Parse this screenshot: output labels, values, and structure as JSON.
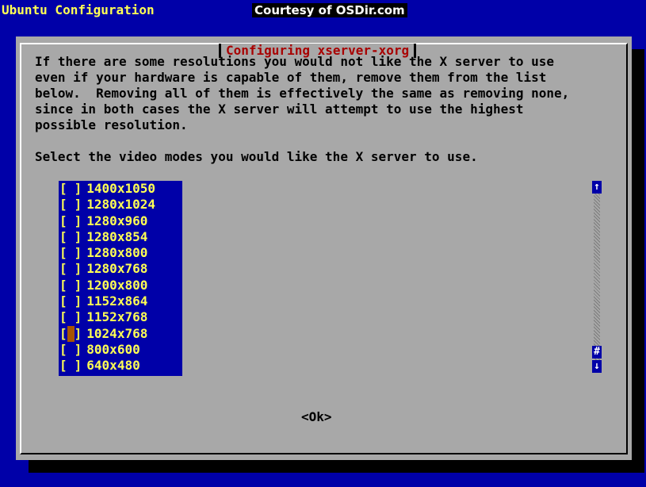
{
  "backtitle": "Ubuntu Configuration",
  "watermark": "Courtesy of OSDir.com",
  "dialog": {
    "title": "Configuring xserver-xorg",
    "description": "If there are some resolutions you would not like the X server to use\neven if your hardware is capable of them, remove them from the list\nbelow.  Removing all of them is effectively the same as removing none,\nsince in both cases the X server will attempt to use the highest\npossible resolution.",
    "prompt": "Select the video modes you would like the X server to use.",
    "ok_label": "<Ok>"
  },
  "modes": [
    {
      "label": "1400x1050",
      "checked": false,
      "cursor": false
    },
    {
      "label": "1280x1024",
      "checked": false,
      "cursor": false
    },
    {
      "label": "1280x960",
      "checked": false,
      "cursor": false
    },
    {
      "label": "1280x854",
      "checked": false,
      "cursor": false
    },
    {
      "label": "1280x800",
      "checked": false,
      "cursor": false
    },
    {
      "label": "1280x768",
      "checked": false,
      "cursor": false
    },
    {
      "label": "1200x800",
      "checked": false,
      "cursor": false
    },
    {
      "label": "1152x864",
      "checked": false,
      "cursor": false
    },
    {
      "label": "1152x768",
      "checked": false,
      "cursor": false
    },
    {
      "label": "1024x768",
      "checked": true,
      "cursor": true
    },
    {
      "label": "800x600",
      "checked": false,
      "cursor": false
    },
    {
      "label": "640x480",
      "checked": false,
      "cursor": false
    }
  ],
  "scrollbar": {
    "up_glyph": "↑",
    "thumb_glyph": "#",
    "down_glyph": "↓",
    "icons": [
      "arrow-up-icon",
      "scroll-thumb-icon",
      "arrow-down-icon"
    ]
  },
  "colors": {
    "screen_bg": "#0000a8",
    "dialog_bg": "#a8a8a8",
    "title": "#a80000",
    "list_text": "#ffff54",
    "cursor": "#a85400"
  }
}
